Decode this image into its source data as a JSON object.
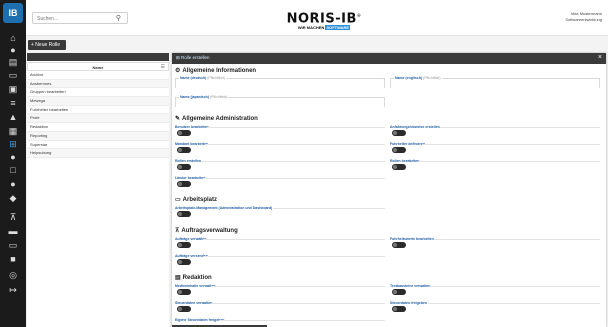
{
  "app": {
    "logo_text": "IB",
    "brand_name": "NORIS-IB",
    "brand_reg": "®",
    "brand_tag_pre": "WIR MACHEN ",
    "brand_tag_highlight": "SOFTWARE"
  },
  "rail": {
    "icons": [
      "home-icon",
      "users-icon",
      "menu-icon",
      "car-icon",
      "desktop-icon",
      "bars-icon",
      "upload-icon",
      "calendar-icon",
      "sitemap-icon",
      "user-icon",
      "box-icon",
      "circle-icon",
      "tag-icon",
      "shopping-cart-icon",
      "layer-icon",
      "folder-icon",
      "lock-icon",
      "clock-icon",
      "logout-icon"
    ],
    "active_index": 8
  },
  "header": {
    "search_placeholder": "Suchen...",
    "user_name": "Max Mustermann",
    "user_role": "Softwareentwicklung"
  },
  "toolbar": {
    "add_label": "+ Neue Rolle"
  },
  "list": {
    "column_header": "Name",
    "rows": [
      "Archive",
      "Ansbernnes",
      "Gruppen bearbeiten",
      "Mewega",
      "Fuhrheiter bearbeiten",
      "Profe",
      "Redaktion",
      "Reporting",
      "Superstar",
      "Helpsubung"
    ]
  },
  "modal": {
    "title": "Rolle erstellen",
    "sections": {
      "general": "Allgemeine Informationen",
      "admin": "Allgemeine Administration",
      "workplace": "Arbeitsplatz",
      "orders": "Auftragsverwaltung",
      "editorial": "Redaktion"
    },
    "fields": {
      "name_de": "Name (deutsch)",
      "name_en": "Name (englisch)",
      "name_jp": "Name (japanisch)",
      "optional": "(Pflichtfeld)"
    },
    "perms": {
      "benutzer": "Benutzer bearbeiten",
      "anwesenheit": "Anfahrungshinweise erstellen",
      "mandant": "Mandant bearbeiten",
      "fuhrheiter": "Fuhrheiter definieren",
      "rollen_erstellen": "Rollen erstellen",
      "rollen_bearbeiten": "Rollen bearbeiten",
      "lander": "Länder bearbeiten",
      "arbeitsplatz": "Arbeitsplatz-Management (Administration und Dashboard)",
      "auftrage_verwalten": "Aufträge verwalten",
      "fuhrheitswerte": "Fuhrheitswerte bearbeiten",
      "auftrage_versenden": "Aufträge versenden",
      "medien": "Medieninhalte verwalten",
      "textbausteine": "Textbausteine verwalten",
      "steuerdaten": "Steuerdaten verwalten",
      "steuerdaten_freigabe": "Steuerdaten freigeben",
      "eigene_freigabe": "Eigene Steuerdaten freigeben"
    }
  }
}
